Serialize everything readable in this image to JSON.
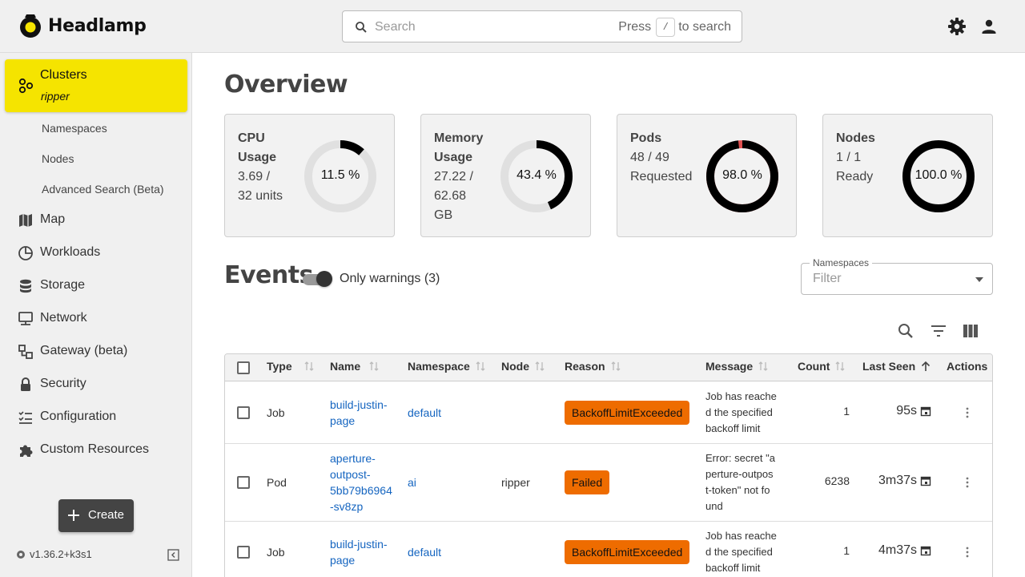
{
  "app": {
    "name": "Headlamp"
  },
  "search": {
    "placeholder": "Search",
    "hint_before": "Press",
    "hint_key": "/",
    "hint_after": "to search"
  },
  "sidebar": {
    "cluster": {
      "label": "Clusters",
      "name": "ripper"
    },
    "subitems": [
      {
        "label": "Namespaces"
      },
      {
        "label": "Nodes"
      },
      {
        "label": "Advanced Search (Beta)"
      }
    ],
    "items": [
      {
        "label": "Map",
        "icon": "map-icon"
      },
      {
        "label": "Workloads",
        "icon": "workloads-icon"
      },
      {
        "label": "Storage",
        "icon": "storage-icon"
      },
      {
        "label": "Network",
        "icon": "network-icon"
      },
      {
        "label": "Gateway (beta)",
        "icon": "gateway-icon"
      },
      {
        "label": "Security",
        "icon": "lock-icon"
      },
      {
        "label": "Configuration",
        "icon": "configuration-icon"
      },
      {
        "label": "Custom Resources",
        "icon": "puzzle-icon"
      }
    ],
    "create_label": "Create",
    "version": "v1.36.2+k3s1"
  },
  "overview": {
    "title": "Overview",
    "cards": [
      {
        "title_lines": [
          "CPU",
          "Usage"
        ],
        "value_lines": [
          "3.69 /",
          "32 units"
        ],
        "percent_label": "11.5 %",
        "percent": 11.5
      },
      {
        "title_lines": [
          "Memory",
          "Usage"
        ],
        "value_lines": [
          "27.22 /",
          "62.68",
          "GB"
        ],
        "percent_label": "43.4 %",
        "percent": 43.4
      },
      {
        "title_lines": [
          "Pods"
        ],
        "value_lines": [
          "48 / 49",
          "Requested"
        ],
        "percent_label": "98.0 %",
        "percent": 98.0
      },
      {
        "title_lines": [
          "Nodes"
        ],
        "value_lines": [
          "1 / 1",
          "Ready"
        ],
        "percent_label": "100.0 %",
        "percent": 100.0
      }
    ]
  },
  "events": {
    "title": "Events",
    "toggle_label": "Only warnings (3)",
    "toggle_on": true,
    "namespace_filter": {
      "label": "Namespaces",
      "placeholder": "Filter"
    },
    "columns": [
      "Type",
      "Name",
      "Namespace",
      "Node",
      "Reason",
      "Message",
      "Count",
      "Last Seen",
      "Actions"
    ],
    "rows": [
      {
        "type": "Job",
        "name_lines": [
          "build-justin-",
          "page"
        ],
        "namespace": "default",
        "node": "",
        "reason": "BackoffLimitExceeded",
        "message_lines": [
          "Job has reache",
          "d the specified",
          "backoff limit"
        ],
        "count": "1",
        "last_seen": "95s"
      },
      {
        "type": "Pod",
        "name_lines": [
          "aperture-",
          "outpost-",
          "5bb79b6964",
          "-sv8zp"
        ],
        "namespace": "ai",
        "node": "ripper",
        "reason": "Failed",
        "message_lines": [
          "Error: secret \"a",
          "perture-outpos",
          "t-token\" not fo",
          "und"
        ],
        "count": "6238",
        "last_seen": "3m37s"
      },
      {
        "type": "Job",
        "name_lines": [
          "build-justin-",
          "page"
        ],
        "namespace": "default",
        "node": "",
        "reason": "BackoffLimitExceeded",
        "message_lines": [
          "Job has reache",
          "d the specified",
          "backoff limit"
        ],
        "count": "1",
        "last_seen": "4m37s"
      }
    ]
  },
  "colors": {
    "accent": "#f5e400",
    "badge": "#ee6c00",
    "link": "#1565c0"
  }
}
